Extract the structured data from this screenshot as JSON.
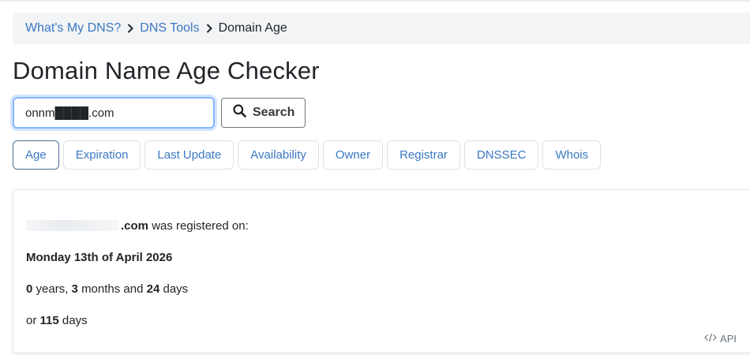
{
  "breadcrumb": {
    "items": [
      {
        "label": "What's My DNS?"
      },
      {
        "label": "DNS Tools"
      },
      {
        "label": "Domain Age"
      }
    ]
  },
  "page": {
    "title": "Domain Name Age Checker"
  },
  "search": {
    "value": "onnm████.com",
    "button_label": "Search",
    "icon": "search-icon"
  },
  "tabs": [
    {
      "label": "Age",
      "active": true
    },
    {
      "label": "Expiration"
    },
    {
      "label": "Last Update"
    },
    {
      "label": "Availability"
    },
    {
      "label": "Owner"
    },
    {
      "label": "Registrar"
    },
    {
      "label": "DNSSEC"
    },
    {
      "label": "Whois"
    }
  ],
  "result": {
    "domain_suffix": ".com",
    "registered_text": "was registered on:",
    "date": "Monday 13th of April 2026",
    "years": "0",
    "years_label": "years,",
    "months": "3",
    "months_label": "months and",
    "days": "24",
    "days_label": "days",
    "total_prefix": "or",
    "total_days": "115",
    "total_label": "days"
  },
  "api": {
    "label": "API",
    "icon": "code-icon"
  },
  "colors": {
    "link": "#3a78c2",
    "breadcrumb_bg": "#f3f4f6",
    "focus": "#86b7fe"
  }
}
